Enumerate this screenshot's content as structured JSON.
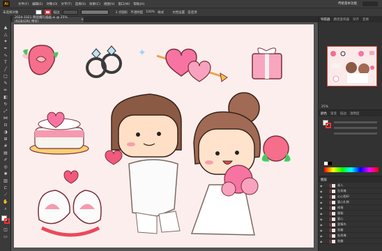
{
  "app": {
    "logo": "Ai",
    "menu": [
      "文件(F)",
      "编辑(E)",
      "对象(O)",
      "文字(T)",
      "选择(S)",
      "效果(C)",
      "视图(V)",
      "窗口(W)",
      "帮助(H)"
    ],
    "workspace": "传统基本功能"
  },
  "control": {
    "selection_label": "未选择对象",
    "stroke_label": "描边",
    "stroke_style": "3 点圆形",
    "opacity_label": "不透明度",
    "opacity_value": "100%",
    "style_label": "样式",
    "doc_settings": "文档设置",
    "preferences": "首选项"
  },
  "document": {
    "tab_title": "2024-1021 情侣婚礼插画.ai @ 25% (RGB/GPU 预览)",
    "close": "×"
  },
  "right_panel": {
    "tabs": [
      "导航器",
      "路径查找器",
      "对齐",
      "变换"
    ],
    "zoom": "25%",
    "color_tabs": [
      "颜色",
      "渐变",
      "描边",
      "透明度"
    ],
    "layers_title": "图层",
    "layers": [
      "叔人",
      "左玫瑰",
      "心心相印",
      "爱心礼物",
      "戒指",
      "蛋糕",
      "爱心",
      "爱情鸟",
      "花瓣",
      "右玫瑰",
      "花瓣"
    ]
  },
  "colors": {
    "accent": "#e84a4a",
    "artboard": "#fdeeee",
    "pink": "#f59ab0",
    "brown": "#8a5a44"
  }
}
